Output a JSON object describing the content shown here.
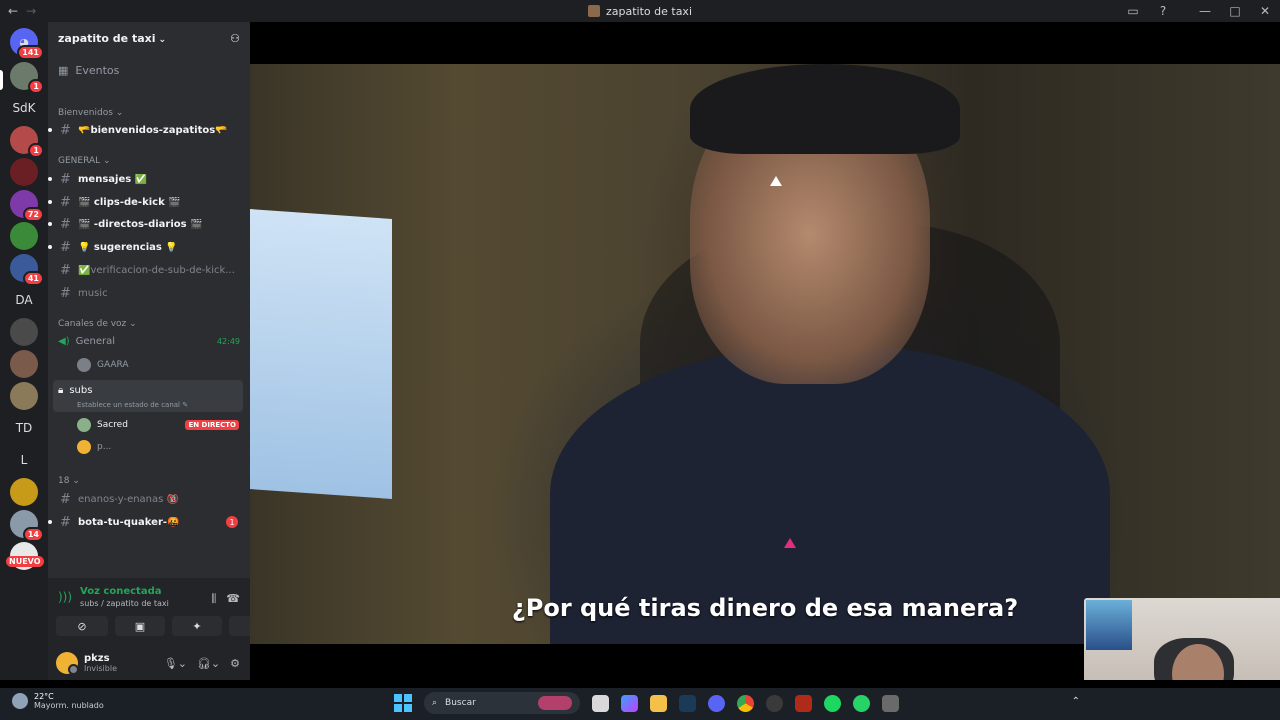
{
  "window": {
    "title": "zapatito de taxi",
    "back": "←",
    "forward": "→"
  },
  "rail": {
    "badges": [
      "141",
      "1",
      "1",
      "72",
      "41",
      "14"
    ],
    "text_servers": [
      "SdK",
      "DA",
      "TD",
      "L"
    ],
    "nuevo": "NUEVO"
  },
  "guild": {
    "name": "zapatito de taxi",
    "events": "Eventos",
    "cat_welcome": "Bienvenidos",
    "ch_welcome": "🫳bienvenidos-zapatitos🫳",
    "cat_general": "GENERAL",
    "ch_mensajes": "mensajes ✅",
    "ch_clips": "🎬 clips-de-kick 🎬",
    "ch_directos": "🎬 -directos-diarios 🎬",
    "ch_sugerencias": "💡 sugerencias 💡",
    "ch_verificacion": "✅verificacion-de-sub-de-kick...",
    "ch_music": "music",
    "cat_voice": "Canales de voz",
    "vc_general": "General",
    "vc_general_time": "42:49",
    "vc_user_gaara": "GAARA",
    "vc_subs": "subs",
    "vc_subs_status": "Establece un estado de canal",
    "vc_user_sacred": "Sacred",
    "live_label": "EN DIRECTO",
    "vc_user_p": "p...",
    "cat_18": "18",
    "ch_enanos": "enanos-y-enanas 🔞",
    "ch_bota": "bota-tu-quaker-🤬",
    "ch_bota_badge": "1"
  },
  "voice_panel": {
    "status": "Voz conectada",
    "location": "subs / zapatito de taxi"
  },
  "user": {
    "name": "pkzs",
    "status": "Invisible"
  },
  "stream": {
    "subtitle": "¿Por qué tiras dinero de esa manera?"
  },
  "taskbar": {
    "temp": "22°C",
    "weather": "Mayorm. nublado",
    "search_placeholder": "Buscar"
  },
  "colors": {
    "accent_green": "#23a55a",
    "badge_red": "#f23f43",
    "bg_sidebar": "#2b2d31",
    "bg_rail": "#1e1f22"
  }
}
